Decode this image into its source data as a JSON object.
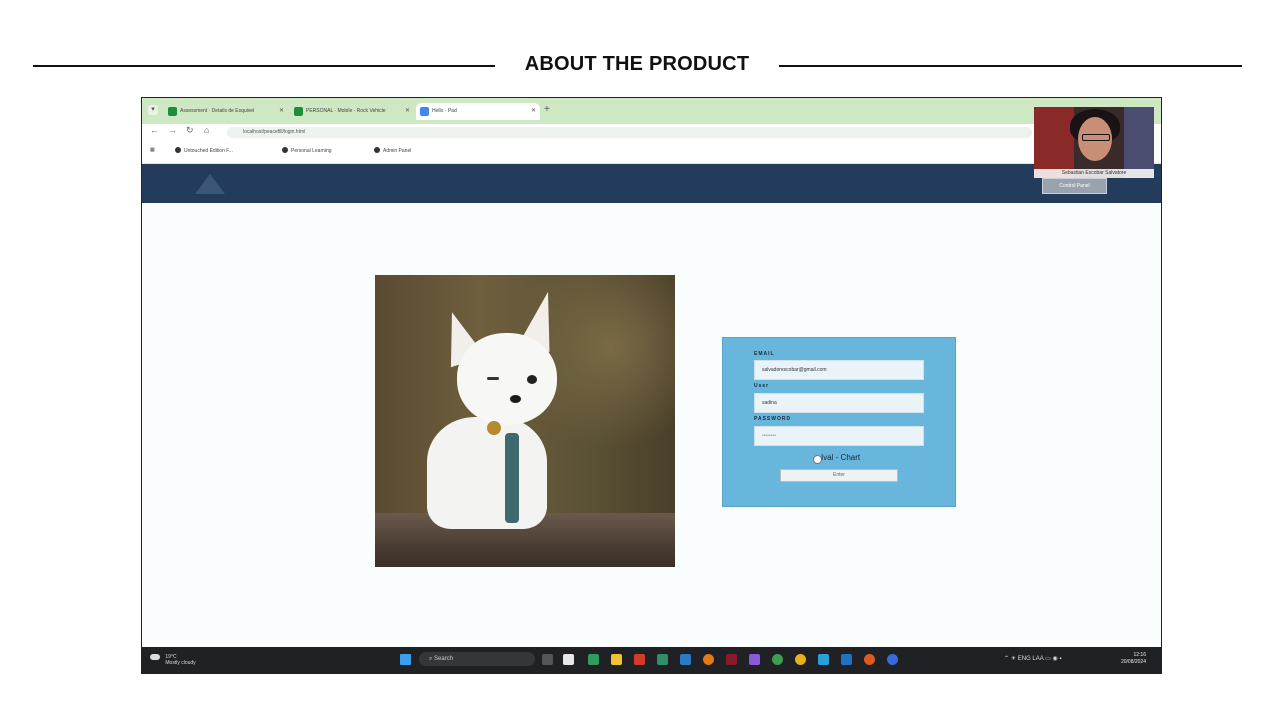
{
  "slide": {
    "title": "ABOUT THE PRODUCT"
  },
  "browser": {
    "tabs": [
      {
        "label": "Assessment · Details de Esquivel",
        "icon_color": "#1e8e3e",
        "icon": "tab-icon"
      },
      {
        "label": "PERSONAL · Mobile · Rock Vehicle",
        "icon_color": "#1e8e3e",
        "icon": "tab-icon"
      },
      {
        "label": "Hello · Pad",
        "icon_color": "#4285f4",
        "icon": "tab-icon"
      }
    ],
    "url": "localhost/peacefill/login.html",
    "bookmarks": [
      "Untouched Edition F...",
      "Personal Learning",
      "Admin Panel"
    ]
  },
  "webcam": {
    "name": "Sebastian Escobar Salvatore"
  },
  "site": {
    "header_button": "Control Panel"
  },
  "login": {
    "email_label": "EMAIL",
    "email_value": "salvadorescobar@gmail.com",
    "user_label": "User",
    "user_value": "sadina",
    "password_label": "PASSWORD",
    "password_value": "••••••••",
    "link_text": "Ival - Chart",
    "button_label": "Enter"
  },
  "taskbar": {
    "weather_temp": "19°C",
    "weather_text": "Mostly cloudy",
    "search_placeholder": "Search",
    "tray_lang": "ENG LAA",
    "time": "12:16",
    "date": "20/08/2024"
  },
  "colors": {
    "site_header": "#233c5b",
    "form_bg": "#68b6dc",
    "tabbar": "#cfe8c4",
    "taskbar": "#202124"
  }
}
